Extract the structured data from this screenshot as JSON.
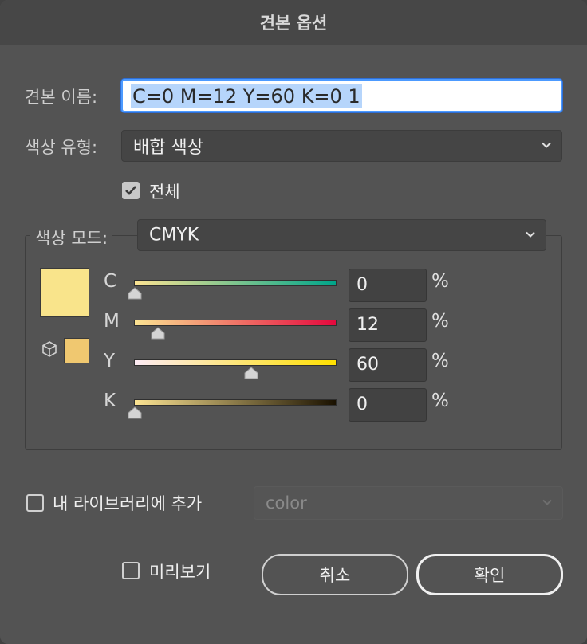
{
  "dialog": {
    "title": "견본 옵션"
  },
  "swatch_name": {
    "label": "견본 이름:",
    "value": "C=0 M=12 Y=60 K=0 1"
  },
  "color_type": {
    "label": "색상 유형:",
    "value": "배합 색상"
  },
  "global": {
    "label": "전체",
    "checked": true
  },
  "color_mode": {
    "label": "색상 모드:",
    "value": "CMYK"
  },
  "channels": [
    {
      "name": "C",
      "value": "0",
      "unit": "%",
      "level": 0,
      "gradient": [
        "#fbe392",
        "#00a58a"
      ]
    },
    {
      "name": "M",
      "value": "12",
      "unit": "%",
      "level": 0.12,
      "gradient": [
        "#fbe392",
        "#e4083d"
      ]
    },
    {
      "name": "Y",
      "value": "60",
      "unit": "%",
      "level": 0.6,
      "gradient": [
        "#fdebf5",
        "#ffe000"
      ]
    },
    {
      "name": "K",
      "value": "0",
      "unit": "%",
      "level": 0,
      "gradient": [
        "#fbe392",
        "#1a1100"
      ]
    }
  ],
  "colors": {
    "swatch": "#f9e48b",
    "gamut_swatch": "#f0c870",
    "accent": "#4c9aff"
  },
  "library": {
    "label": "내 라이브러리에 추가",
    "checked": false,
    "select_value": "color"
  },
  "preview": {
    "label": "미리보기",
    "checked": false
  },
  "buttons": {
    "cancel": "취소",
    "ok": "확인"
  }
}
